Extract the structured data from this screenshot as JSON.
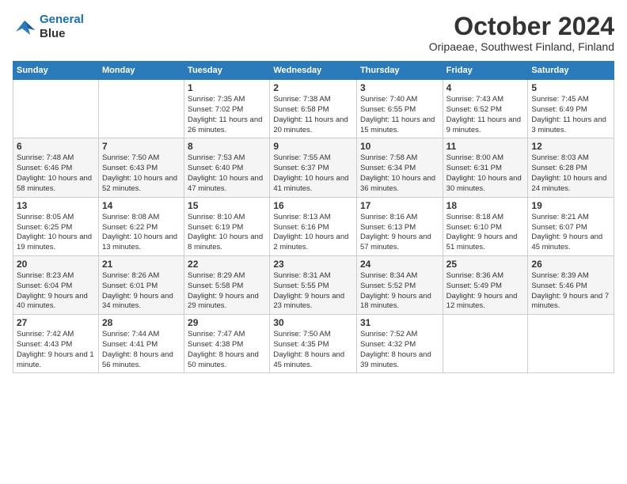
{
  "logo": {
    "line1": "General",
    "line2": "Blue"
  },
  "title": "October 2024",
  "subtitle": "Oripaeae, Southwest Finland, Finland",
  "days_header": [
    "Sunday",
    "Monday",
    "Tuesday",
    "Wednesday",
    "Thursday",
    "Friday",
    "Saturday"
  ],
  "weeks": [
    [
      {
        "day": "",
        "info": ""
      },
      {
        "day": "",
        "info": ""
      },
      {
        "day": "1",
        "info": "Sunrise: 7:35 AM\nSunset: 7:02 PM\nDaylight: 11 hours and 26 minutes."
      },
      {
        "day": "2",
        "info": "Sunrise: 7:38 AM\nSunset: 6:58 PM\nDaylight: 11 hours and 20 minutes."
      },
      {
        "day": "3",
        "info": "Sunrise: 7:40 AM\nSunset: 6:55 PM\nDaylight: 11 hours and 15 minutes."
      },
      {
        "day": "4",
        "info": "Sunrise: 7:43 AM\nSunset: 6:52 PM\nDaylight: 11 hours and 9 minutes."
      },
      {
        "day": "5",
        "info": "Sunrise: 7:45 AM\nSunset: 6:49 PM\nDaylight: 11 hours and 3 minutes."
      }
    ],
    [
      {
        "day": "6",
        "info": "Sunrise: 7:48 AM\nSunset: 6:46 PM\nDaylight: 10 hours and 58 minutes."
      },
      {
        "day": "7",
        "info": "Sunrise: 7:50 AM\nSunset: 6:43 PM\nDaylight: 10 hours and 52 minutes."
      },
      {
        "day": "8",
        "info": "Sunrise: 7:53 AM\nSunset: 6:40 PM\nDaylight: 10 hours and 47 minutes."
      },
      {
        "day": "9",
        "info": "Sunrise: 7:55 AM\nSunset: 6:37 PM\nDaylight: 10 hours and 41 minutes."
      },
      {
        "day": "10",
        "info": "Sunrise: 7:58 AM\nSunset: 6:34 PM\nDaylight: 10 hours and 36 minutes."
      },
      {
        "day": "11",
        "info": "Sunrise: 8:00 AM\nSunset: 6:31 PM\nDaylight: 10 hours and 30 minutes."
      },
      {
        "day": "12",
        "info": "Sunrise: 8:03 AM\nSunset: 6:28 PM\nDaylight: 10 hours and 24 minutes."
      }
    ],
    [
      {
        "day": "13",
        "info": "Sunrise: 8:05 AM\nSunset: 6:25 PM\nDaylight: 10 hours and 19 minutes."
      },
      {
        "day": "14",
        "info": "Sunrise: 8:08 AM\nSunset: 6:22 PM\nDaylight: 10 hours and 13 minutes."
      },
      {
        "day": "15",
        "info": "Sunrise: 8:10 AM\nSunset: 6:19 PM\nDaylight: 10 hours and 8 minutes."
      },
      {
        "day": "16",
        "info": "Sunrise: 8:13 AM\nSunset: 6:16 PM\nDaylight: 10 hours and 2 minutes."
      },
      {
        "day": "17",
        "info": "Sunrise: 8:16 AM\nSunset: 6:13 PM\nDaylight: 9 hours and 57 minutes."
      },
      {
        "day": "18",
        "info": "Sunrise: 8:18 AM\nSunset: 6:10 PM\nDaylight: 9 hours and 51 minutes."
      },
      {
        "day": "19",
        "info": "Sunrise: 8:21 AM\nSunset: 6:07 PM\nDaylight: 9 hours and 45 minutes."
      }
    ],
    [
      {
        "day": "20",
        "info": "Sunrise: 8:23 AM\nSunset: 6:04 PM\nDaylight: 9 hours and 40 minutes."
      },
      {
        "day": "21",
        "info": "Sunrise: 8:26 AM\nSunset: 6:01 PM\nDaylight: 9 hours and 34 minutes."
      },
      {
        "day": "22",
        "info": "Sunrise: 8:29 AM\nSunset: 5:58 PM\nDaylight: 9 hours and 29 minutes."
      },
      {
        "day": "23",
        "info": "Sunrise: 8:31 AM\nSunset: 5:55 PM\nDaylight: 9 hours and 23 minutes."
      },
      {
        "day": "24",
        "info": "Sunrise: 8:34 AM\nSunset: 5:52 PM\nDaylight: 9 hours and 18 minutes."
      },
      {
        "day": "25",
        "info": "Sunrise: 8:36 AM\nSunset: 5:49 PM\nDaylight: 9 hours and 12 minutes."
      },
      {
        "day": "26",
        "info": "Sunrise: 8:39 AM\nSunset: 5:46 PM\nDaylight: 9 hours and 7 minutes."
      }
    ],
    [
      {
        "day": "27",
        "info": "Sunrise: 7:42 AM\nSunset: 4:43 PM\nDaylight: 9 hours and 1 minute."
      },
      {
        "day": "28",
        "info": "Sunrise: 7:44 AM\nSunset: 4:41 PM\nDaylight: 8 hours and 56 minutes."
      },
      {
        "day": "29",
        "info": "Sunrise: 7:47 AM\nSunset: 4:38 PM\nDaylight: 8 hours and 50 minutes."
      },
      {
        "day": "30",
        "info": "Sunrise: 7:50 AM\nSunset: 4:35 PM\nDaylight: 8 hours and 45 minutes."
      },
      {
        "day": "31",
        "info": "Sunrise: 7:52 AM\nSunset: 4:32 PM\nDaylight: 8 hours and 39 minutes."
      },
      {
        "day": "",
        "info": ""
      },
      {
        "day": "",
        "info": ""
      }
    ]
  ]
}
